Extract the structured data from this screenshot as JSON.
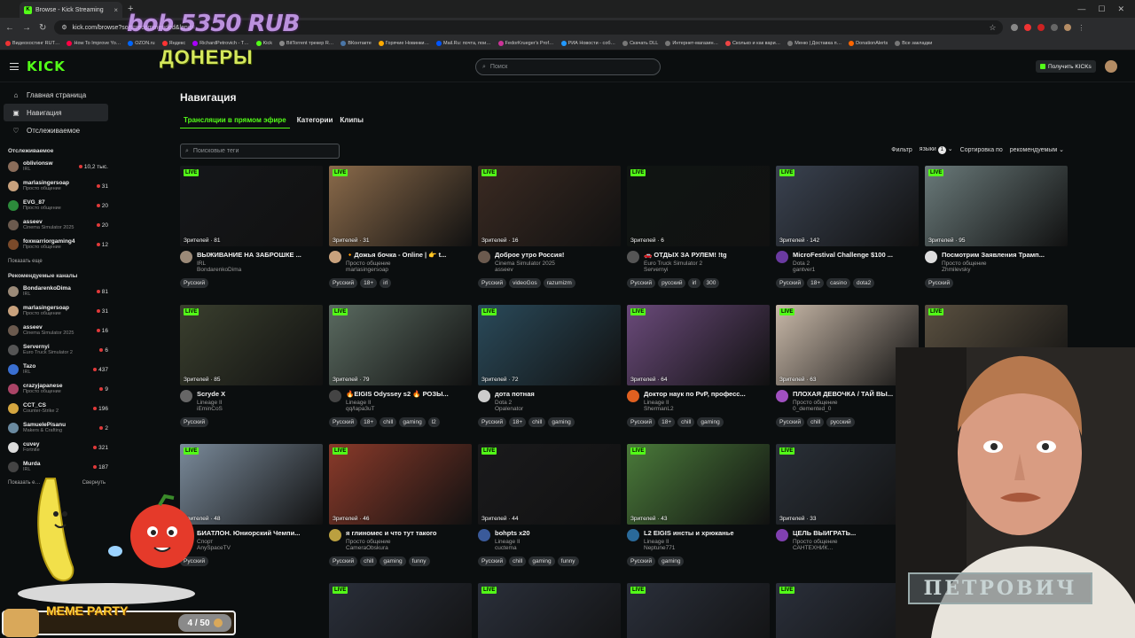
{
  "browser": {
    "tab_title": "Browse - Kick Streaming",
    "url": "kick.com/browse?sort=recommended&lang=",
    "bookmarks": [
      {
        "label": "Видеохостинг RUT…",
        "color": "#e33"
      },
      {
        "label": "How To Improve Yo…",
        "color": "#f04"
      },
      {
        "label": "OZON.ru",
        "color": "#06f"
      },
      {
        "label": "Яндекс",
        "color": "#f33"
      },
      {
        "label": "RichardPetrovich - T…",
        "color": "#a0f"
      },
      {
        "label": "Kick",
        "color": "#53fc18"
      },
      {
        "label": "BitTorrent трекер R…",
        "color": "#888"
      },
      {
        "label": "ВКонтакте",
        "color": "#4a76a8"
      },
      {
        "label": "Горячие Новинки…",
        "color": "#fa0"
      },
      {
        "label": "Mail.Ru: почта, пои…",
        "color": "#05f"
      },
      {
        "label": "FedorKrueger's Prof…",
        "color": "#c39"
      },
      {
        "label": "РИА Новости - соб…",
        "color": "#29f"
      },
      {
        "label": "Скачать DLL",
        "color": "#777"
      },
      {
        "label": "Интернет-магазин…",
        "color": "#777"
      },
      {
        "label": "Сколько и как вари…",
        "color": "#e44"
      },
      {
        "label": "Меню | Доставка п…",
        "color": "#777"
      },
      {
        "label": "DonationAlerts",
        "color": "#f60"
      },
      {
        "label": "Все закладки",
        "color": "#777"
      }
    ]
  },
  "overlay": {
    "donation": "bob 5350 RUB",
    "doner": "ДОНЕРЫ",
    "meme_title": "MEME PARTY",
    "meme_count": "4 / 50",
    "webcam_caption": "ПЕТРОВИЧ"
  },
  "header": {
    "logo": "KICK",
    "search_placeholder": "Поиск",
    "get_kicks": "Получить KICKs"
  },
  "sidebar": {
    "nav": [
      {
        "label": "Главная страница",
        "icon": "home-icon",
        "glyph": "⌂"
      },
      {
        "label": "Навигация",
        "icon": "browse-icon",
        "glyph": "▣"
      },
      {
        "label": "Отслеживаемое",
        "icon": "heart-icon",
        "glyph": "♡"
      }
    ],
    "following_title": "Отслеживаемое",
    "following": [
      {
        "name": "oblivionsw",
        "cat": "IRL",
        "viewers": "10,2 тыс.",
        "color": "#8a6d5a"
      },
      {
        "name": "marlasingersoap",
        "cat": "Просто общение",
        "viewers": "31",
        "color": "#c9a27d"
      },
      {
        "name": "EVG_87",
        "cat": "Просто общение",
        "viewers": "20",
        "color": "#2c8a3b"
      },
      {
        "name": "asseev",
        "cat": "Cinema Simulator 2025",
        "viewers": "20",
        "color": "#6b5a4e"
      },
      {
        "name": "foxwarriorgaming4",
        "cat": "Просто общение",
        "viewers": "12",
        "color": "#7a4a2a"
      }
    ],
    "show_more": "Показать еще",
    "recommended_title": "Рекомендуемые каналы",
    "recommended": [
      {
        "name": "BondarenkoDima",
        "cat": "IRL",
        "viewers": "81",
        "color": "#9b8a78"
      },
      {
        "name": "marlasingersoap",
        "cat": "Просто общение",
        "viewers": "31",
        "color": "#c9a27d"
      },
      {
        "name": "asseev",
        "cat": "Cinema Simulator 2025",
        "viewers": "16",
        "color": "#6b5a4e"
      },
      {
        "name": "Servernyi",
        "cat": "Euro Truck Simulator 2",
        "viewers": "6",
        "color": "#555"
      },
      {
        "name": "Tazo",
        "cat": "IRL",
        "viewers": "437",
        "color": "#3a6fd1"
      },
      {
        "name": "crazyjapanese",
        "cat": "Просто общение",
        "viewers": "9",
        "color": "#aa4466"
      },
      {
        "name": "CCT_CS",
        "cat": "Counter-Strike 2",
        "viewers": "196",
        "color": "#d4a640"
      },
      {
        "name": "SamuelePisanu",
        "cat": "Makers & Crafting",
        "viewers": "2",
        "color": "#6a8aa0"
      },
      {
        "name": "cuvey",
        "cat": "Fortnite",
        "viewers": "321",
        "color": "#ddd"
      },
      {
        "name": "Murda",
        "cat": "IRL",
        "viewers": "187",
        "color": "#444"
      }
    ],
    "show_less": "Показать е…",
    "collapse": "Свернуть"
  },
  "main": {
    "title": "Навигация",
    "tabs": [
      "Трансляции в прямом эфире",
      "Категории",
      "Клипы"
    ],
    "tag_search_placeholder": "Поисковые теги",
    "filter_label": "Фильтр",
    "lang_label": "языки",
    "lang_count": "1",
    "sort_label": "Сортировка по",
    "sort_value": "рекомендуемым",
    "live_label": "LIVE",
    "viewers_prefix": "Зрителей · ",
    "cards": [
      {
        "viewers": "81",
        "title": "ВЫЖИВАНИЕ НА ЗАБРОШКЕ ...",
        "user": "BondarenkoDima",
        "cat": "IRL",
        "tags": [
          "Русский"
        ],
        "bg": "#15171a",
        "av": "#9b8a78"
      },
      {
        "viewers": "31",
        "title": "🔸Дожья бочка - Online | 👉 t...",
        "user": "marlasingersoap",
        "cat": "Просто общение",
        "tags": [
          "Русский",
          "18+",
          "irl"
        ],
        "bg": "#8a6a4a",
        "av": "#c9a27d"
      },
      {
        "viewers": "16",
        "title": "Доброе утро Россия!",
        "user": "asseev",
        "cat": "Cinema Simulator 2025",
        "tags": [
          "Русский",
          "videoGos",
          "razumizm"
        ],
        "bg": "#3a2a22",
        "av": "#6b5a4e"
      },
      {
        "viewers": "6",
        "title": "🚗 ОТДЫХ ЗА РУЛЕМ! !tg",
        "user": "Servernyi",
        "cat": "Euro Truck Simulator 2",
        "tags": [
          "Русский",
          "русский",
          "irl",
          "300"
        ],
        "bg": "#101512",
        "av": "#555"
      },
      {
        "viewers": "142",
        "title": "MicroFestival Challenge $100 ...",
        "user": "gantver1",
        "cat": "Dota 2",
        "tags": [
          "Русский",
          "18+",
          "casino",
          "dota2"
        ],
        "bg": "#3a4250",
        "av": "#6a3aa0"
      },
      {
        "viewers": "95",
        "title": "Посмотрим Заявления Трамп...",
        "user": "Zhmilevsky",
        "cat": "Просто общение",
        "tags": [
          "Русский"
        ],
        "bg": "#6a7a7a",
        "av": "#ddd"
      },
      {
        "viewers": "85",
        "title": "Scryde X",
        "user": "iEminCoS",
        "cat": "Lineage II",
        "tags": [
          "Русский"
        ],
        "bg": "#3a3f2e",
        "av": "#666"
      },
      {
        "viewers": "79",
        "title": "🔥EIGIS Odyssey s2 🔥 РОЗЫ...",
        "user": "qq/lapa3uT",
        "cat": "Lineage II",
        "tags": [
          "Русский",
          "18+",
          "chill",
          "gaming",
          "l2"
        ],
        "bg": "#5a6a60",
        "av": "#444"
      },
      {
        "viewers": "72",
        "title": "дота потная",
        "user": "Opalenator",
        "cat": "Dota 2",
        "tags": [
          "Русский",
          "18+",
          "chill",
          "gaming"
        ],
        "bg": "#2a4a5a",
        "av": "#ccc"
      },
      {
        "viewers": "64",
        "title": "Доктор наук по PvP, професс...",
        "user": "ShermanL2",
        "cat": "Lineage II",
        "tags": [
          "Русский",
          "18+",
          "chill",
          "gaming"
        ],
        "bg": "#6a4a7a",
        "av": "#e06020"
      },
      {
        "viewers": "63",
        "title": "ПЛОХАЯ ДЕВОЧКА / ТАЙ ВЫ...",
        "user": "0_demented_0",
        "cat": "Просто общение",
        "tags": [
          "Русский",
          "chill",
          "русский"
        ],
        "bg": "#c8b8a8",
        "av": "#a050c0"
      },
      {
        "viewers": "3",
        "title": "",
        "user": "",
        "cat": "",
        "tags": [],
        "bg": "#5a5040",
        "av": "#555"
      },
      {
        "viewers": "48",
        "title": "БИАТЛОН. Юниорский Чемпи...",
        "user": "AnySpaceTV",
        "cat": "Спорт",
        "tags": [
          "Русский"
        ],
        "bg": "#7a8a9a",
        "av": "#444"
      },
      {
        "viewers": "46",
        "title": "я глиномес и что тут такого",
        "user": "CameraObskura",
        "cat": "Просто общение",
        "tags": [
          "Русский",
          "chill",
          "gaming",
          "funny"
        ],
        "bg": "#8a3a2a",
        "av": "#bba040"
      },
      {
        "viewers": "44",
        "title": "bohpts x20",
        "user": "cuctema",
        "cat": "Lineage II",
        "tags": [
          "Русский",
          "chill",
          "gaming",
          "funny"
        ],
        "bg": "#1a1a1c",
        "av": "#3a5a9a"
      },
      {
        "viewers": "43",
        "title": "L2 EIGIS инсты и хрюканье",
        "user": "Neptune771",
        "cat": "Lineage II",
        "tags": [
          "Русский",
          "gaming"
        ],
        "bg": "#4a7a3a",
        "av": "#2a6a9a"
      },
      {
        "viewers": "33",
        "title": "ЦЕЛЬ ВЫИГРАТЬ...",
        "user": "САНТЕХНИК…",
        "cat": "Просто общение",
        "tags": [],
        "bg": "#2a3038",
        "av": "#8040b0"
      }
    ]
  }
}
